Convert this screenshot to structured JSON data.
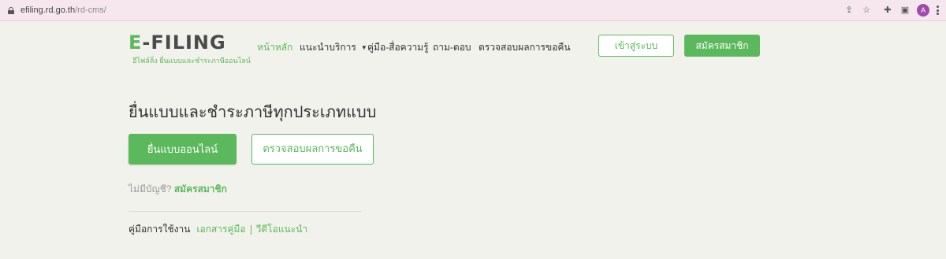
{
  "browser": {
    "url_domain": "efiling.rd.go.th",
    "url_path": "/rd-cms/",
    "profile_initial": "A"
  },
  "logo": {
    "wordmark_e": "E",
    "wordmark_rest": "-FILING",
    "tagline": "อีไฟล์ลิ่ง ยื่นแบบและชำระภาษีออนไลน์"
  },
  "nav": {
    "home": "หน้าหลัก",
    "services": "แนะนำบริการ",
    "manuals": "คู่มือ-สื่อความรู้",
    "faq": "ถาม-ตอบ",
    "refund_check": "ตรวจสอบผลการขอคืน",
    "login": "เข้าสู่ระบบ",
    "register": "สมัครสมาชิก"
  },
  "main": {
    "headline": "ยื่นแบบและชำระภาษีทุกประเภทแบบ",
    "file_online": "ยื่นแบบออนไลน์",
    "check_refund": "ตรวจสอบผลการขอคืน",
    "no_account": "ไม่มีบัญชี?",
    "register_link": "สมัครสมาชิก",
    "manual_label": "คู่มือการใช้งาน",
    "manual_doc": "เอกสารคู่มือ",
    "manual_video": "วีดีโอแนะนำ"
  },
  "colors": {
    "brand_green": "#5cb85c",
    "background": "#f2f2ec"
  }
}
